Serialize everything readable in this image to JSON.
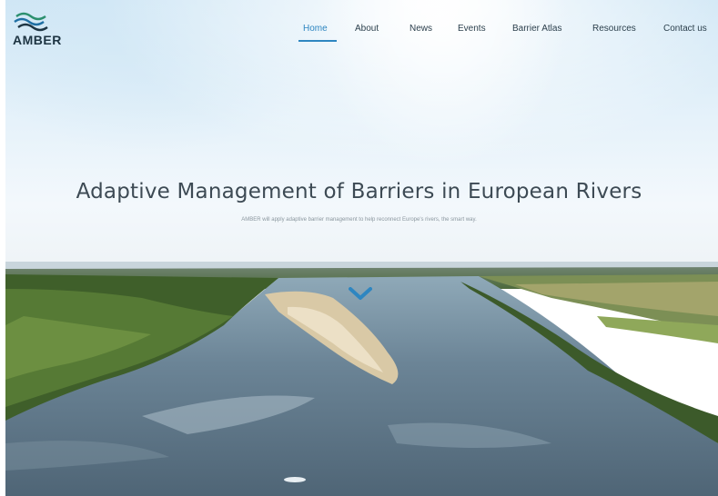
{
  "logo": {
    "text": "AMBER",
    "icon": "amber-waves-logo"
  },
  "nav": {
    "items": [
      {
        "label": "Home",
        "active": true
      },
      {
        "label": "About"
      },
      {
        "label": "News"
      },
      {
        "label": "Events"
      },
      {
        "label": "Barrier Atlas"
      },
      {
        "label": "Resources"
      },
      {
        "label": "Contact us"
      }
    ],
    "active_color": "#2e86c1"
  },
  "hero": {
    "title": "Adaptive Management of Barriers in European Rivers",
    "subtitle": "AMBER will apply adaptive barrier management to help reconnect Europe's rivers, the smart way.",
    "scroll_icon": "chevron-down-icon"
  }
}
